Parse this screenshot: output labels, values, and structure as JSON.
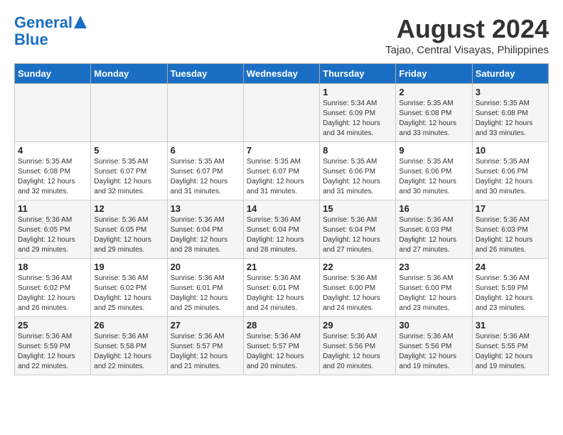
{
  "logo": {
    "line1": "General",
    "line2": "Blue"
  },
  "title": "August 2024",
  "subtitle": "Tajao, Central Visayas, Philippines",
  "days_of_week": [
    "Sunday",
    "Monday",
    "Tuesday",
    "Wednesday",
    "Thursday",
    "Friday",
    "Saturday"
  ],
  "weeks": [
    [
      {
        "day": "",
        "info": ""
      },
      {
        "day": "",
        "info": ""
      },
      {
        "day": "",
        "info": ""
      },
      {
        "day": "",
        "info": ""
      },
      {
        "day": "1",
        "info": "Sunrise: 5:34 AM\nSunset: 6:09 PM\nDaylight: 12 hours\nand 34 minutes."
      },
      {
        "day": "2",
        "info": "Sunrise: 5:35 AM\nSunset: 6:08 PM\nDaylight: 12 hours\nand 33 minutes."
      },
      {
        "day": "3",
        "info": "Sunrise: 5:35 AM\nSunset: 6:08 PM\nDaylight: 12 hours\nand 33 minutes."
      }
    ],
    [
      {
        "day": "4",
        "info": "Sunrise: 5:35 AM\nSunset: 6:08 PM\nDaylight: 12 hours\nand 32 minutes."
      },
      {
        "day": "5",
        "info": "Sunrise: 5:35 AM\nSunset: 6:07 PM\nDaylight: 12 hours\nand 32 minutes."
      },
      {
        "day": "6",
        "info": "Sunrise: 5:35 AM\nSunset: 6:07 PM\nDaylight: 12 hours\nand 31 minutes."
      },
      {
        "day": "7",
        "info": "Sunrise: 5:35 AM\nSunset: 6:07 PM\nDaylight: 12 hours\nand 31 minutes."
      },
      {
        "day": "8",
        "info": "Sunrise: 5:35 AM\nSunset: 6:06 PM\nDaylight: 12 hours\nand 31 minutes."
      },
      {
        "day": "9",
        "info": "Sunrise: 5:35 AM\nSunset: 6:06 PM\nDaylight: 12 hours\nand 30 minutes."
      },
      {
        "day": "10",
        "info": "Sunrise: 5:35 AM\nSunset: 6:06 PM\nDaylight: 12 hours\nand 30 minutes."
      }
    ],
    [
      {
        "day": "11",
        "info": "Sunrise: 5:36 AM\nSunset: 6:05 PM\nDaylight: 12 hours\nand 29 minutes."
      },
      {
        "day": "12",
        "info": "Sunrise: 5:36 AM\nSunset: 6:05 PM\nDaylight: 12 hours\nand 29 minutes."
      },
      {
        "day": "13",
        "info": "Sunrise: 5:36 AM\nSunset: 6:04 PM\nDaylight: 12 hours\nand 28 minutes."
      },
      {
        "day": "14",
        "info": "Sunrise: 5:36 AM\nSunset: 6:04 PM\nDaylight: 12 hours\nand 28 minutes."
      },
      {
        "day": "15",
        "info": "Sunrise: 5:36 AM\nSunset: 6:04 PM\nDaylight: 12 hours\nand 27 minutes."
      },
      {
        "day": "16",
        "info": "Sunrise: 5:36 AM\nSunset: 6:03 PM\nDaylight: 12 hours\nand 27 minutes."
      },
      {
        "day": "17",
        "info": "Sunrise: 5:36 AM\nSunset: 6:03 PM\nDaylight: 12 hours\nand 26 minutes."
      }
    ],
    [
      {
        "day": "18",
        "info": "Sunrise: 5:36 AM\nSunset: 6:02 PM\nDaylight: 12 hours\nand 26 minutes."
      },
      {
        "day": "19",
        "info": "Sunrise: 5:36 AM\nSunset: 6:02 PM\nDaylight: 12 hours\nand 25 minutes."
      },
      {
        "day": "20",
        "info": "Sunrise: 5:36 AM\nSunset: 6:01 PM\nDaylight: 12 hours\nand 25 minutes."
      },
      {
        "day": "21",
        "info": "Sunrise: 5:36 AM\nSunset: 6:01 PM\nDaylight: 12 hours\nand 24 minutes."
      },
      {
        "day": "22",
        "info": "Sunrise: 5:36 AM\nSunset: 6:00 PM\nDaylight: 12 hours\nand 24 minutes."
      },
      {
        "day": "23",
        "info": "Sunrise: 5:36 AM\nSunset: 6:00 PM\nDaylight: 12 hours\nand 23 minutes."
      },
      {
        "day": "24",
        "info": "Sunrise: 5:36 AM\nSunset: 5:59 PM\nDaylight: 12 hours\nand 23 minutes."
      }
    ],
    [
      {
        "day": "25",
        "info": "Sunrise: 5:36 AM\nSunset: 5:59 PM\nDaylight: 12 hours\nand 22 minutes."
      },
      {
        "day": "26",
        "info": "Sunrise: 5:36 AM\nSunset: 5:58 PM\nDaylight: 12 hours\nand 22 minutes."
      },
      {
        "day": "27",
        "info": "Sunrise: 5:36 AM\nSunset: 5:57 PM\nDaylight: 12 hours\nand 21 minutes."
      },
      {
        "day": "28",
        "info": "Sunrise: 5:36 AM\nSunset: 5:57 PM\nDaylight: 12 hours\nand 20 minutes."
      },
      {
        "day": "29",
        "info": "Sunrise: 5:36 AM\nSunset: 5:56 PM\nDaylight: 12 hours\nand 20 minutes."
      },
      {
        "day": "30",
        "info": "Sunrise: 5:36 AM\nSunset: 5:56 PM\nDaylight: 12 hours\nand 19 minutes."
      },
      {
        "day": "31",
        "info": "Sunrise: 5:36 AM\nSunset: 5:55 PM\nDaylight: 12 hours\nand 19 minutes."
      }
    ]
  ]
}
